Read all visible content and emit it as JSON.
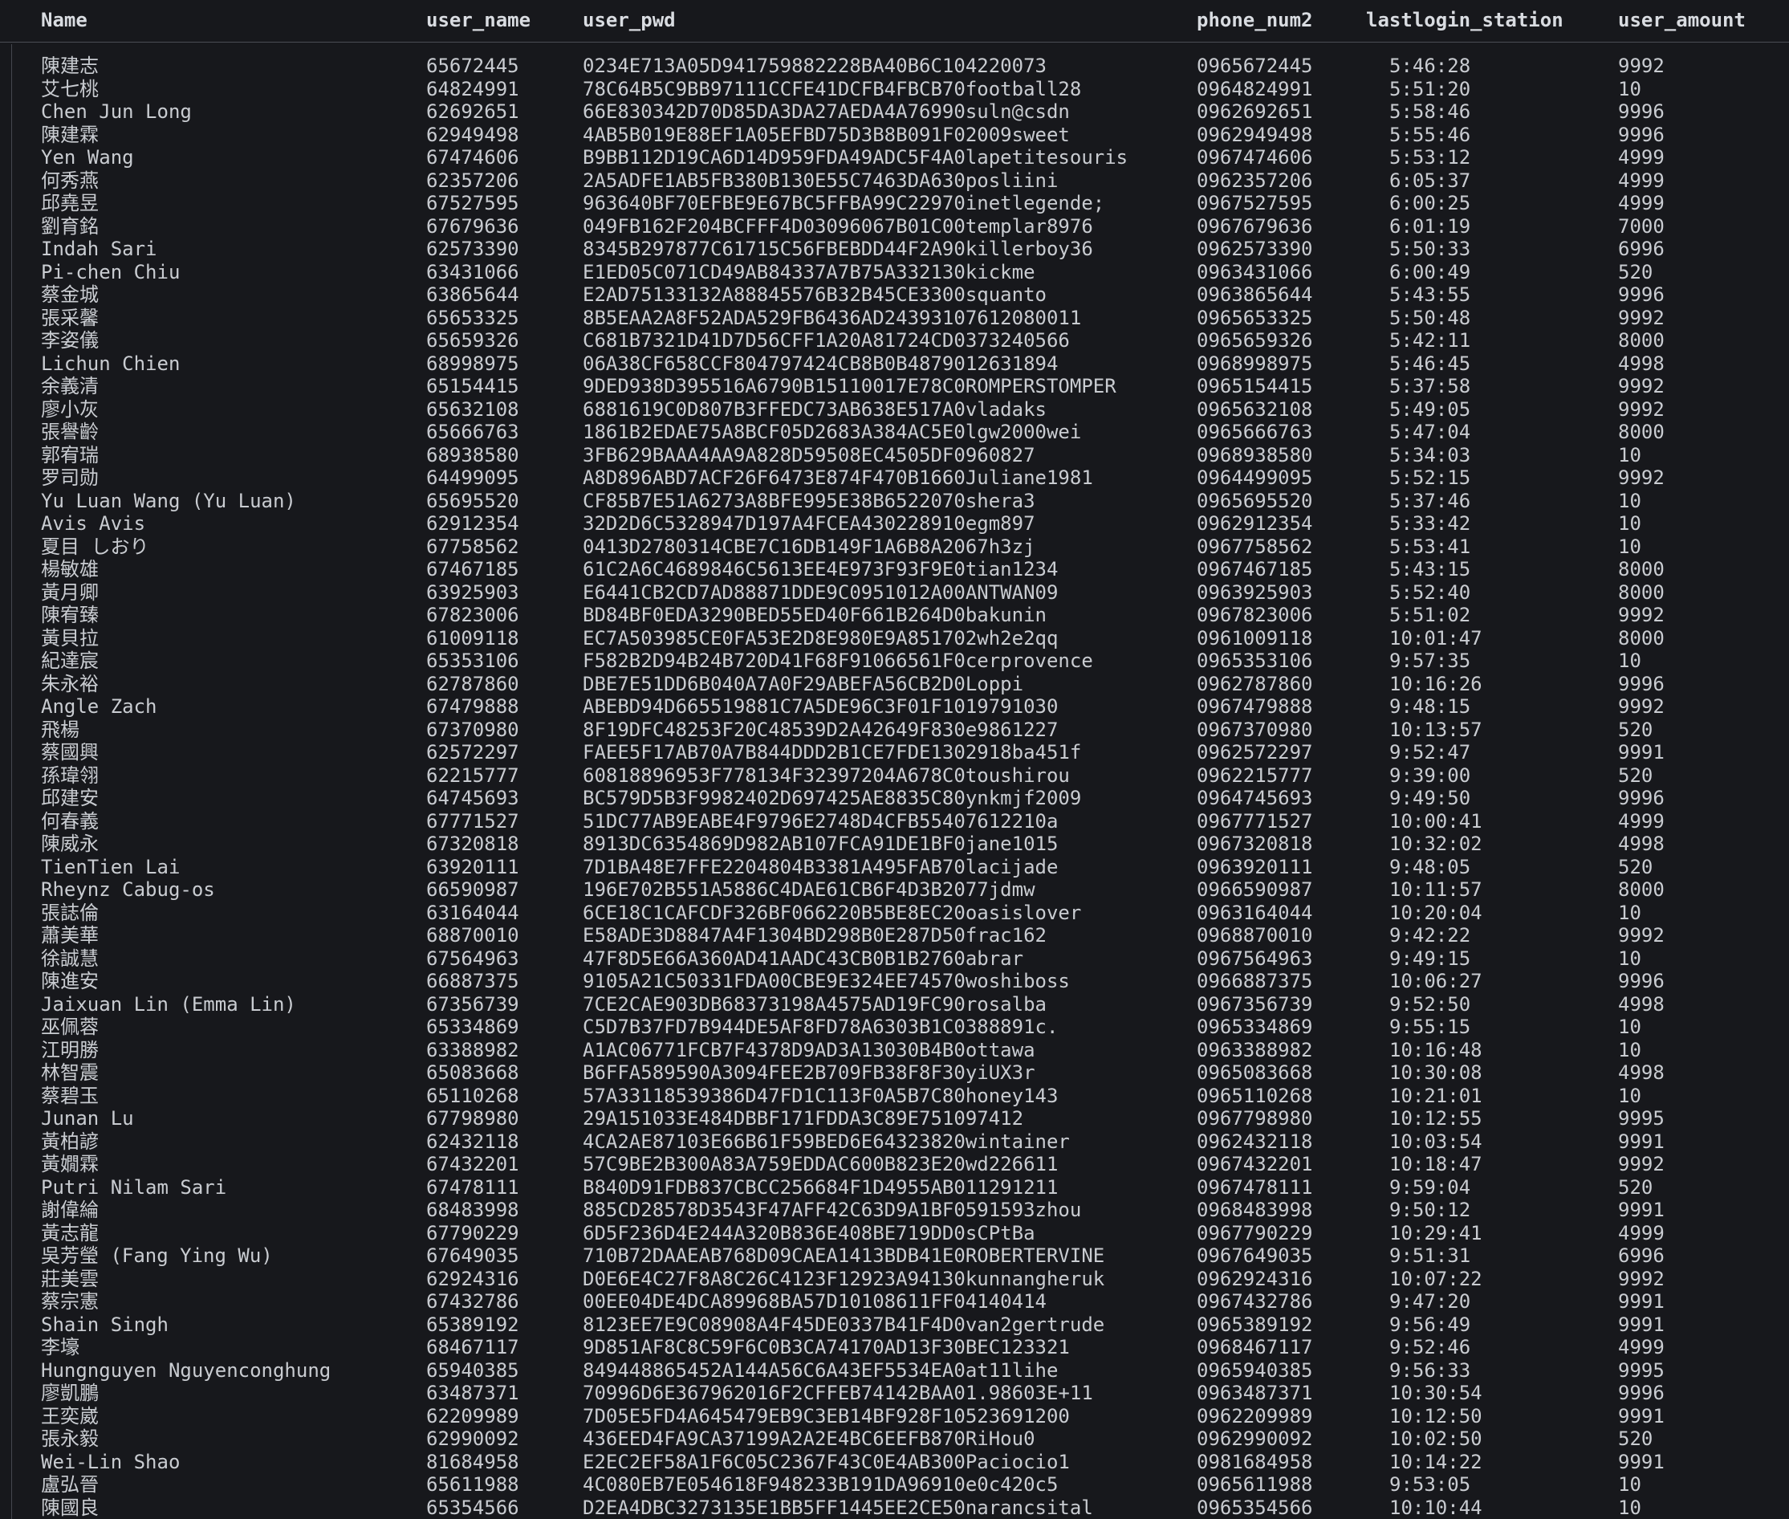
{
  "columns": [
    "Name",
    "user_name",
    "user_pwd",
    "phone_num2",
    "lastlogin_station",
    "user_amount"
  ],
  "rows": [
    [
      "陳建志",
      "65672445",
      "0234E713A05D941759882228BA40B6C104220073",
      "0965672445",
      "5:46:28",
      "9992"
    ],
    [
      "艾七桃",
      "64824991",
      "78C64B5C9BB97111CCFE41DCFB4FBCB70football28",
      "0964824991",
      "5:51:20",
      "10"
    ],
    [
      "Chen Jun Long",
      "62692651",
      "66E830342D70D85DA3DA27AEDA4A76990suln@csdn",
      "0962692651",
      "5:58:46",
      "9996"
    ],
    [
      "陳建霖",
      "62949498",
      "4AB5B019E88EF1A05EFBD75D3B8B091F02009sweet",
      "0962949498",
      "5:55:46",
      "9996"
    ],
    [
      "Yen Wang",
      "67474606",
      "B9BB112D19CA6D14D959FDA49ADC5F4A0lapetitesouris",
      "0967474606",
      "5:53:12",
      "4999"
    ],
    [
      "何秀燕",
      "62357206",
      "2A5ADFE1AB5FB380B130E55C7463DA630posliini",
      "0962357206",
      "6:05:37",
      "4999"
    ],
    [
      "邱堯昱",
      "67527595",
      "963640BF70EFBE9E67BC5FFBA99C22970inetlegende;",
      "0967527595",
      "6:00:25",
      "4999"
    ],
    [
      "劉育銘",
      "67679636",
      "049FB162F204BCFFF4D03096067B01C00templar8976",
      "0967679636",
      "6:01:19",
      "7000"
    ],
    [
      "Indah Sari",
      "62573390",
      "8345B297877C61715C56FBEBDD44F2A90killerboy36",
      "0962573390",
      "5:50:33",
      "6996"
    ],
    [
      "Pi-chen Chiu",
      "63431066",
      "E1ED05C071CD49AB84337A7B75A332130kickme",
      "0963431066",
      "6:00:49",
      "520"
    ],
    [
      "蔡金城",
      "63865644",
      "E2AD75133132A88845576B32B45CE3300squanto",
      "0963865644",
      "5:43:55",
      "9996"
    ],
    [
      "張采馨",
      "65653325",
      "8B5EAA2A8F52ADA529FB6436AD24393107612080011",
      "0965653325",
      "5:50:48",
      "9992"
    ],
    [
      "李姿儀",
      "65659326",
      "C681B7321D41D7D56CFF1A20A81724CD0373240566",
      "0965659326",
      "5:42:11",
      "8000"
    ],
    [
      "Lichun Chien",
      "68998975",
      "06A38CF658CCF804797424CB8B0B4879012631894",
      "0968998975",
      "5:46:45",
      "4998"
    ],
    [
      "余義清",
      "65154415",
      "9DED938D395516A6790B15110017E78C0ROMPERSTOMPER",
      "0965154415",
      "5:37:58",
      "9992"
    ],
    [
      "廖小灰",
      "65632108",
      "6881619C0D807B3FFEDC73AB638E517A0vladaks",
      "0965632108",
      "5:49:05",
      "9992"
    ],
    [
      "張譽齡",
      "65666763",
      "1861B2EDAE75A8BCF05D2683A384AC5E0lgw2000wei",
      "0965666763",
      "5:47:04",
      "8000"
    ],
    [
      "郭宥瑞",
      "68938580",
      "3FB629BAAA4AA9A828D59508EC4505DF0960827",
      "0968938580",
      "5:34:03",
      "10"
    ],
    [
      "罗司勋",
      "64499095",
      "A8D896ABD7ACF26F6473E874F470B1660Juliane1981",
      "0964499095",
      "5:52:15",
      "9992"
    ],
    [
      "Yu Luan Wang (Yu Luan)",
      "65695520",
      "CF85B7E51A6273A8BFE995E38B6522070shera3",
      "0965695520",
      "5:37:46",
      "10"
    ],
    [
      "Avis Avis",
      "62912354",
      "32D2D6C5328947D197A4FCEA430228910egm897",
      "0962912354",
      "5:33:42",
      "10"
    ],
    [
      "夏目 しおり",
      "67758562",
      "0413D2780314CBE7C16DB149F1A6B8A2067h3zj",
      "0967758562",
      "5:53:41",
      "10"
    ],
    [
      "楊敏雄",
      "67467185",
      "61C2A6C4689846C5613EE4E973F93F9E0tian1234",
      "0967467185",
      "5:43:15",
      "8000"
    ],
    [
      "黃月卿",
      "63925903",
      "E6441CB2CD7AD88871DDE9C0951012A00ANTWAN09",
      "0963925903",
      "5:52:40",
      "8000"
    ],
    [
      "陳宥臻",
      "67823006",
      "BD84BF0EDA3290BED55ED40F661B264D0bakunin",
      "0967823006",
      "5:51:02",
      "9992"
    ],
    [
      "黃貝拉",
      "61009118",
      "EC7A503985CE0FA53E2D8E980E9A851702wh2e2qq",
      "0961009118",
      "10:01:47",
      "8000"
    ],
    [
      "紀達宸",
      "65353106",
      "F582B2D94B24B720D41F68F91066561F0cerprovence",
      "0965353106",
      "9:57:35",
      "10"
    ],
    [
      "朱永裕",
      "62787860",
      "DBE7E51DD6B040A7A0F29ABEFA56CB2D0Loppi",
      "0962787860",
      "10:16:26",
      "9996"
    ],
    [
      "Angle Zach",
      "67479888",
      "ABEBD94D665519881C7A5DE96C3F01F1019791030",
      "0967479888",
      "9:48:15",
      "9992"
    ],
    [
      "飛楊",
      "67370980",
      "8F19DFC48253F20C48539D2A42649F830e9861227",
      "0967370980",
      "10:13:57",
      "520"
    ],
    [
      "蔡國興",
      "62572297",
      "FAEE5F17AB70A7B844DDD2B1CE7FDE1302918ba451f",
      "0962572297",
      "9:52:47",
      "9991"
    ],
    [
      "孫瑋翎",
      "62215777",
      "60818896953F778134F32397204A678C0toushirou",
      "0962215777",
      "9:39:00",
      "520"
    ],
    [
      "邱建安",
      "64745693",
      "BC579D5B3F9982402D697425AE8835C80ynkmjf2009",
      "0964745693",
      "9:49:50",
      "9996"
    ],
    [
      "何春義",
      "67771527",
      "51DC77AB9EABE4F9796E2748D4CFB55407612210a",
      "0967771527",
      "10:00:41",
      "4999"
    ],
    [
      "陳威永",
      "67320818",
      "8913DC6354869D982AB107FCA91DE1BF0jane1015",
      "0967320818",
      "10:32:02",
      "4998"
    ],
    [
      "TienTien Lai",
      "63920111",
      "7D1BA48E7FFE2204804B3381A495FAB70lacijade",
      "0963920111",
      "9:48:05",
      "520"
    ],
    [
      "Rheynz Cabug-os",
      "66590987",
      "196E702B551A5886C4DAE61CB6F4D3B2077jdmw",
      "0966590987",
      "10:11:57",
      "8000"
    ],
    [
      "張誌倫",
      "63164044",
      "6CE18C1CAFCDF326BF066220B5BE8EC20oasislover",
      "0963164044",
      "10:20:04",
      "10"
    ],
    [
      "蕭美華",
      "68870010",
      "E58ADE3D8847A4F1304BD298B0E287D50frac162",
      "0968870010",
      "9:42:22",
      "9992"
    ],
    [
      "徐誠慧",
      "67564963",
      "47F8D5E66A360AD41AADC43CB0B1B2760abrar",
      "0967564963",
      "9:49:15",
      "10"
    ],
    [
      "陳進安",
      "66887375",
      "9105A21C50331FDA00CBE9E324EE74570woshiboss",
      "0966887375",
      "10:06:27",
      "9996"
    ],
    [
      "Jaixuan Lin (Emma Lin)",
      "67356739",
      "7CE2CAE903DB68373198A4575AD19FC90rosalba",
      "0967356739",
      "9:52:50",
      "4998"
    ],
    [
      "巫佩蓉",
      "65334869",
      "C5D7B37FD7B944DE5AF8FD78A6303B1C0388891c.",
      "0965334869",
      "9:55:15",
      "10"
    ],
    [
      "江明勝",
      "63388982",
      "A1AC06771FCB7F4378D9AD3A13030B4B0ottawa",
      "0963388982",
      "10:16:48",
      "10"
    ],
    [
      "林智震",
      "65083668",
      "B6FFA589590A3094FEE2B709FB38F8F30yiUX3r",
      "0965083668",
      "10:30:08",
      "4998"
    ],
    [
      "蔡碧玉",
      "65110268",
      "57A33118539386D47FD1C113F0A5B7C80honey143",
      "0965110268",
      "10:21:01",
      "10"
    ],
    [
      "Junan Lu",
      "67798980",
      "29A151033E484DBBF171FDDA3C89E751097412",
      "0967798980",
      "10:12:55",
      "9995"
    ],
    [
      "黃柏諺",
      "62432118",
      "4CA2AE87103E66B61F59BED6E64323820wintainer",
      "0962432118",
      "10:03:54",
      "9991"
    ],
    [
      "黃嫺霖",
      "67432201",
      "57C9BE2B300A83A759EDDAC600B823E20wd226611",
      "0967432201",
      "10:18:47",
      "9992"
    ],
    [
      "Putri Nilam Sari",
      "67478111",
      "B840D91FDB837CBCC256684F1D4955AB011291211",
      "0967478111",
      "9:59:04",
      "520"
    ],
    [
      "謝偉綸",
      "68483998",
      "885CD28578D3543F47AFF42C63D9A1BF0591593zhou",
      "0968483998",
      "9:50:12",
      "9991"
    ],
    [
      "黃志龍",
      "67790229",
      "6D5F236D4E244A320B836E408BE719DD0sCPtBa",
      "0967790229",
      "10:29:41",
      "4999"
    ],
    [
      "吳芳瑩 (Fang Ying Wu)",
      "67649035",
      "710B72DAAEAB768D09CAEA1413BDB41E0ROBERTERVINE",
      "0967649035",
      "9:51:31",
      "6996"
    ],
    [
      "莊美雲",
      "62924316",
      "D0E6E4C27F8A8C26C4123F12923A94130kunnangheruk",
      "0962924316",
      "10:07:22",
      "9992"
    ],
    [
      "蔡宗憲",
      "67432786",
      "00EE04DE4DCA89968BA57D10108611FF04140414",
      "0967432786",
      "9:47:20",
      "9991"
    ],
    [
      "Shain Singh",
      "65389192",
      "8123EE7E9C08908A4F45DE0337B41F4D0van2gertrude",
      "0965389192",
      "9:56:49",
      "9991"
    ],
    [
      "李壕",
      "68467117",
      "9D851AF8C8C59F6C0B3CA74170AD13F30BEC123321",
      "0968467117",
      "9:52:46",
      "4999"
    ],
    [
      "Hungnguyen Nguyenconghung",
      "65940385",
      "849448865452A144A56C6A43EF5534EA0at11lihe",
      "0965940385",
      "9:56:33",
      "9995"
    ],
    [
      "廖凱鵬",
      "63487371",
      "70996D6E367962016F2CFFEB74142BAA01.98603E+11",
      "0963487371",
      "10:30:54",
      "9996"
    ],
    [
      "王奕崴",
      "62209989",
      "7D05E5FD4A645479EB9C3EB14BF928F10523691200",
      "0962209989",
      "10:12:50",
      "9991"
    ],
    [
      "張永毅",
      "62990092",
      "436EED4FA9CA37199A2A2E4BC6EEFB870RiHou0",
      "0962990092",
      "10:02:50",
      "520"
    ],
    [
      "Wei-Lin Shao",
      "81684958",
      "E2EC2EF58A1F6C05C2367F43C0E4AB300Paciocio1",
      "0981684958",
      "10:14:22",
      "9991"
    ],
    [
      "盧弘晉",
      "65611988",
      "4C080EB7E054618F948233B191DA96910e0c420c5",
      "0965611988",
      "9:53:05",
      "10"
    ],
    [
      "陳國良",
      "65354566",
      "D2EA4DBC3273135E1BB5FF1445EE2CE50narancsital",
      "0965354566",
      "10:10:44",
      "10"
    ]
  ]
}
